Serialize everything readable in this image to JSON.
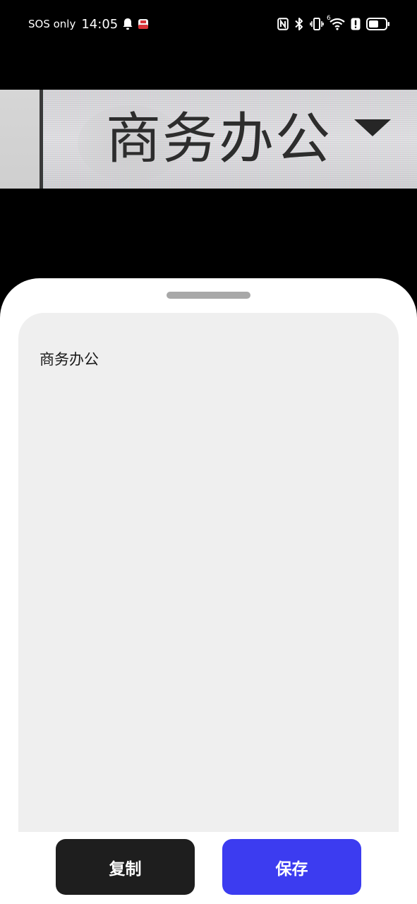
{
  "status_bar": {
    "carrier": "SOS only",
    "time": "14:05",
    "icons_left": [
      "bell-icon",
      "app-notification-icon"
    ],
    "icons_right": [
      "nfc-icon",
      "bluetooth-icon",
      "vibrate-icon",
      "wifi-icon",
      "alert-icon",
      "battery-icon"
    ],
    "wifi_superscript": "6"
  },
  "preview": {
    "captured_text": "商务办公",
    "arrow_icon": "dropdown-arrow-icon"
  },
  "sheet": {
    "result_text": "商务办公"
  },
  "actions": {
    "copy_label": "复制",
    "save_label": "保存"
  },
  "colors": {
    "copy_button": "#1e1e1e",
    "save_button": "#3c3cf0",
    "card_bg": "#efefef",
    "sheet_bg": "#ffffff"
  }
}
